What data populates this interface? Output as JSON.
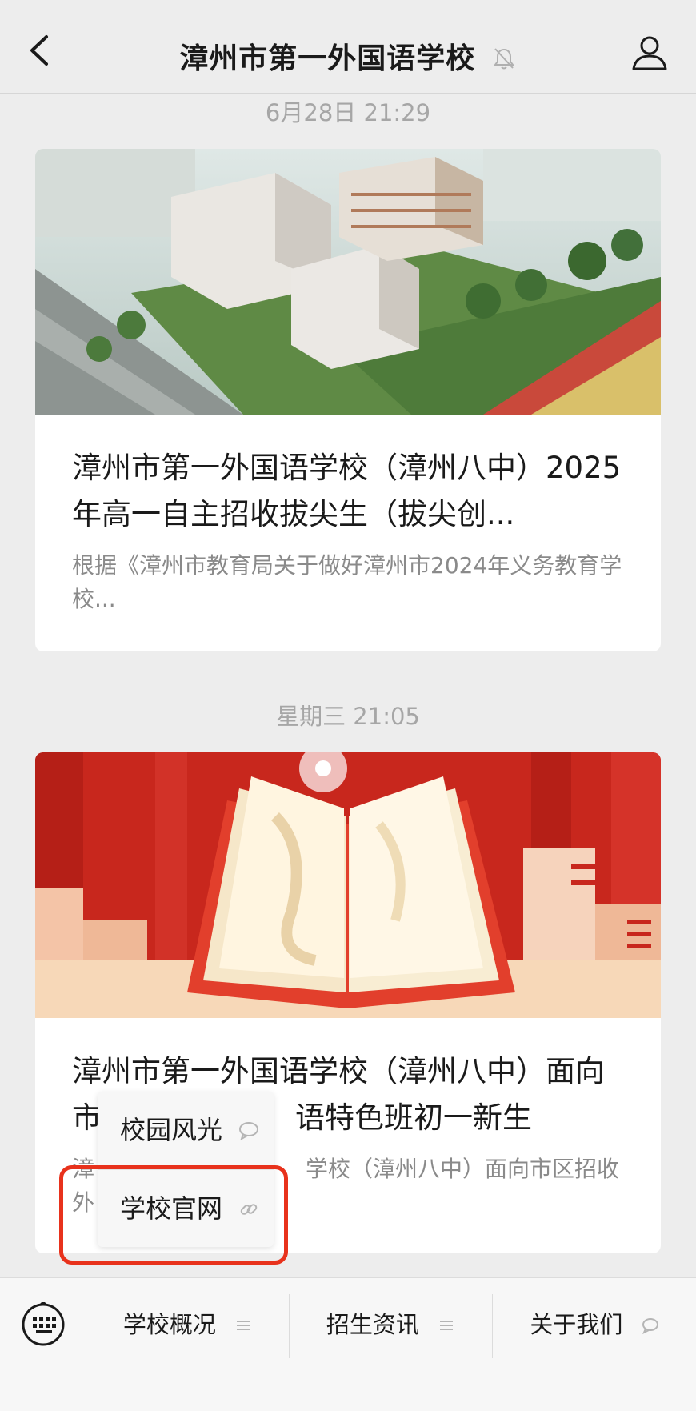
{
  "header": {
    "title": "漳州市第一外国语学校",
    "back_icon": "chevron-left-icon",
    "mute_icon": "bell-muted-icon",
    "profile_icon": "person-icon"
  },
  "messages": [
    {
      "time": "6月28日 21:29",
      "title": "漳州市第一外国语学校（漳州八中）2025年高一自主招收拔尖生（拔尖创...",
      "desc": "根据《漳州市教育局关于做好漳州市2024年义务教育学校..."
    },
    {
      "time": "星期三 21:05",
      "title_line1": "漳州市第一外国语学校（漳州八中）面向",
      "title_line2_start": "市",
      "title_line2_end": "语特色班初一新生",
      "desc_line1_start": "漳",
      "desc_line1_end": "学校（漳州八中）面向市区招收",
      "desc_line2_start": "外"
    }
  ],
  "submenu": {
    "items": [
      {
        "label": "校园风光",
        "icon": "chat-bubble-icon"
      },
      {
        "label": "学校官网",
        "icon": "link-icon"
      }
    ],
    "highlight_color": "#e8321c"
  },
  "bottom_menu": {
    "keyboard_icon": "keyboard-icon",
    "items": [
      {
        "label": "学校概况",
        "icon": "menu-lines-icon"
      },
      {
        "label": "招生资讯",
        "icon": "menu-lines-icon"
      },
      {
        "label": "关于我们",
        "icon": "chat-bubble-icon"
      }
    ]
  }
}
